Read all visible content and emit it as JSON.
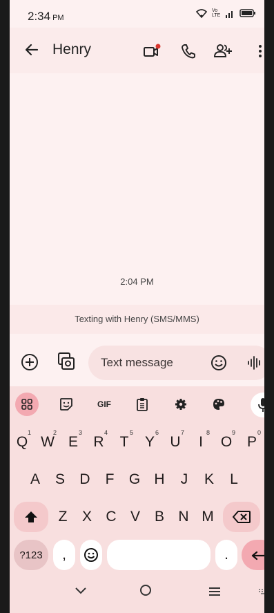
{
  "status": {
    "time": "2:34",
    "ampm": "PM",
    "lte": "Vo LTE",
    "signal": "4G"
  },
  "appbar": {
    "title": "Henry"
  },
  "conversation": {
    "timestamp": "2:04 PM",
    "info": "Texting with Henry (SMS/MMS)"
  },
  "compose": {
    "placeholder": "Text message"
  },
  "toolbar": {
    "gif": "GIF"
  },
  "keyboard": {
    "row1": [
      {
        "k": "Q",
        "h": "1"
      },
      {
        "k": "W",
        "h": "2"
      },
      {
        "k": "E",
        "h": "3"
      },
      {
        "k": "R",
        "h": "4"
      },
      {
        "k": "T",
        "h": "5"
      },
      {
        "k": "Y",
        "h": "6"
      },
      {
        "k": "U",
        "h": "7"
      },
      {
        "k": "I",
        "h": "8"
      },
      {
        "k": "O",
        "h": "9"
      },
      {
        "k": "P",
        "h": "0"
      }
    ],
    "row2": [
      "A",
      "S",
      "D",
      "F",
      "G",
      "H",
      "J",
      "K",
      "L"
    ],
    "row3": [
      "Z",
      "X",
      "C",
      "V",
      "B",
      "N",
      "M"
    ],
    "sym_label": "?123",
    "comma": ",",
    "period": "."
  }
}
